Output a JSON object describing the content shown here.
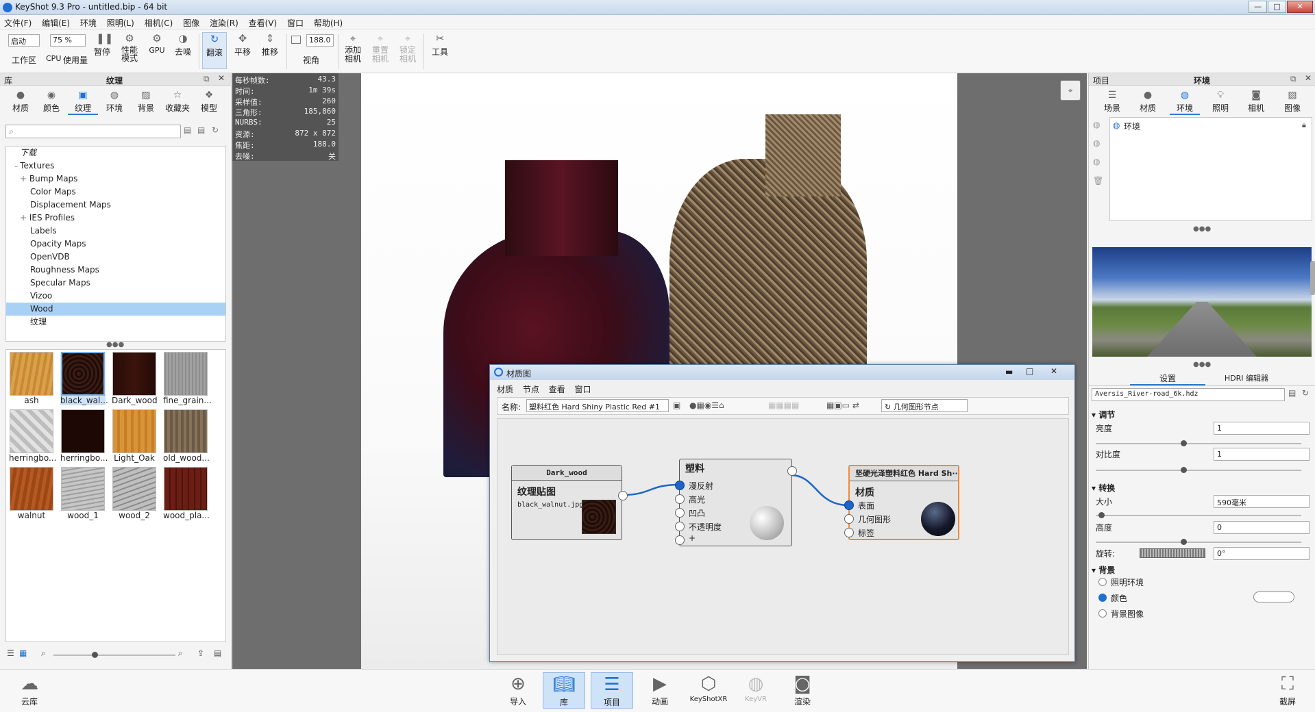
{
  "window": {
    "title": "KeyShot 9.3 Pro  - untitled.bip  - 64 bit",
    "min": "—",
    "max": "□",
    "close": "✕"
  },
  "menu": [
    "文件(F)",
    "编辑(E)",
    "环境",
    "照明(L)",
    "相机(C)",
    "图像",
    "渲染(R)",
    "查看(V)",
    "窗口",
    "帮助(H)"
  ],
  "toolbar": {
    "workspace_select": "启动",
    "workspace": "工作区",
    "cpu_select": "75 %",
    "cpu_label1": "CPU",
    "cpu_label2": "使用量",
    "pause": "暂停",
    "perf_mode": "性能\n模式",
    "gpu": "GPU",
    "denoise": "去噪",
    "tumble": "翻滚",
    "pan": "平移",
    "dolly": "推移",
    "fov_value": "188.0",
    "fov": "视角",
    "add_camera": "添加\n相机",
    "reset_camera": "重置\n相机",
    "lock_camera": "锁定\n相机",
    "tools": "工具"
  },
  "library": {
    "panel_left": "库",
    "panel_title": "纹理",
    "tabs": [
      "材质",
      "颜色",
      "纹理",
      "环境",
      "背景",
      "收藏夹",
      "模型"
    ],
    "search_placeholder": "",
    "tree": [
      "下载",
      "Textures",
      "Bump Maps",
      "Color Maps",
      "Displacement Maps",
      "IES Profiles",
      "Labels",
      "Opacity Maps",
      "OpenVDB",
      "Roughness Maps",
      "Specular Maps",
      "Vizoo",
      "Wood",
      "纹理"
    ],
    "thumbs": [
      "ash",
      "black_wal...",
      "Dark_wood",
      "fine_grain...",
      "herringbo...",
      "herringbo...",
      "Light_Oak",
      "old_wood...",
      "walnut",
      "wood_1",
      "wood_2",
      "wood_pla..."
    ]
  },
  "hud": [
    [
      "每秒帧数:",
      "43.3"
    ],
    [
      "时间:",
      "1m 39s"
    ],
    [
      "采样值:",
      "260"
    ],
    [
      "三角形:",
      "185,860"
    ],
    [
      "NURBS:",
      "25"
    ],
    [
      "资源:",
      "872 x 872"
    ],
    [
      "焦距:",
      "188.0"
    ],
    [
      "去噪:",
      "关"
    ]
  ],
  "material_graph": {
    "title": "材质图",
    "menu": [
      "材质",
      "节点",
      "查看",
      "窗口"
    ],
    "name_label": "名称:",
    "name_value": "塑料红色 Hard Shiny Plastic Red #1",
    "geometry_node_btn": "几何图形节点",
    "node_texture": {
      "header": "Dark_wood",
      "title": "纹理贴图",
      "file": "black_walnut.jpg"
    },
    "node_plastic": {
      "title": "塑料",
      "ports": [
        "漫反射",
        "高光",
        "凹凸",
        "不透明度",
        "+"
      ]
    },
    "node_material": {
      "header": "坚硬光泽塑料红色 Hard Sh···",
      "title": "材质",
      "ports": [
        "表面",
        "几何图形",
        "标签"
      ]
    }
  },
  "project": {
    "panel_left": "项目",
    "panel_title": "环境",
    "tabs": [
      "场景",
      "材质",
      "环境",
      "照明",
      "相机",
      "图像"
    ],
    "env_item": "环境",
    "subtabs": [
      "设置",
      "HDRI 编辑器"
    ],
    "hdri_file": "Aversis_River-road_6k.hdz",
    "sections": {
      "adjust": "调节",
      "transform": "转换",
      "background": "背景"
    },
    "brightness_label": "亮度",
    "brightness": "1",
    "contrast_label": "对比度",
    "contrast": "1",
    "size_label": "大小",
    "size": "590毫米",
    "height_label": "高度",
    "height": "0",
    "rotation_label": "旋转:",
    "rotation": "0°",
    "bg_options": [
      "照明环境",
      "颜色",
      "背景图像"
    ]
  },
  "bottom": {
    "cloud": "云库",
    "import": "导入",
    "library": "库",
    "project": "项目",
    "animation": "动画",
    "keyshotxr": "KeyShotXR",
    "keyvr": "KeyVR",
    "render": "渲染",
    "screenshot": "截屏"
  }
}
